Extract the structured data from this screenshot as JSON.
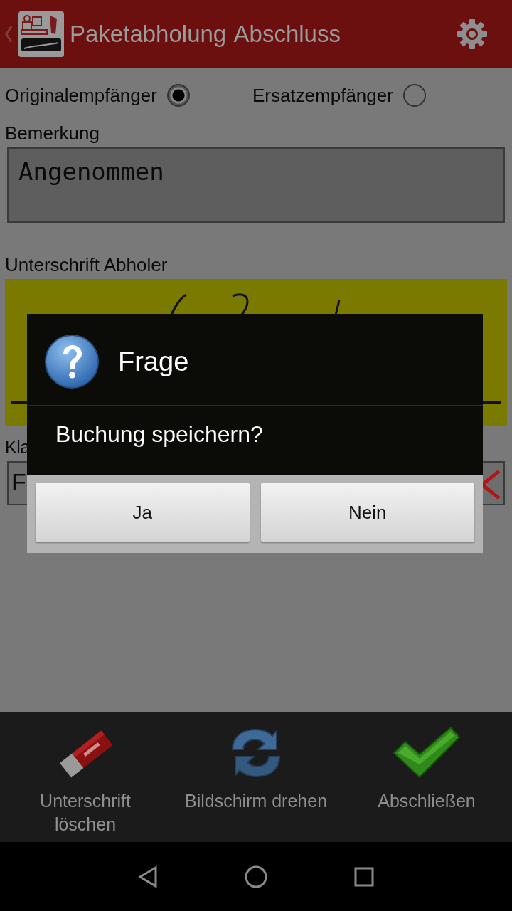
{
  "app_bar": {
    "title": "Paketabholung Abschluss"
  },
  "recipient_options": [
    {
      "label": "Originalempfänger",
      "selected": true
    },
    {
      "label": "Ersatzempfänger",
      "selected": false
    }
  ],
  "remark": {
    "label": "Bemerkung",
    "value": "Angenommen"
  },
  "signature": {
    "label": "Unterschrift Abholer"
  },
  "name_field": {
    "label": "Kla",
    "value": "F"
  },
  "dialog": {
    "title": "Frage",
    "message": "Buchung speichern?",
    "buttons": [
      "Ja",
      "Nein"
    ]
  },
  "actions": [
    {
      "kind": "erase",
      "label": "Unterschrift löschen"
    },
    {
      "kind": "rotate",
      "label": "Bildschirm drehen"
    },
    {
      "kind": "confirm",
      "label": "Abschließen"
    }
  ]
}
